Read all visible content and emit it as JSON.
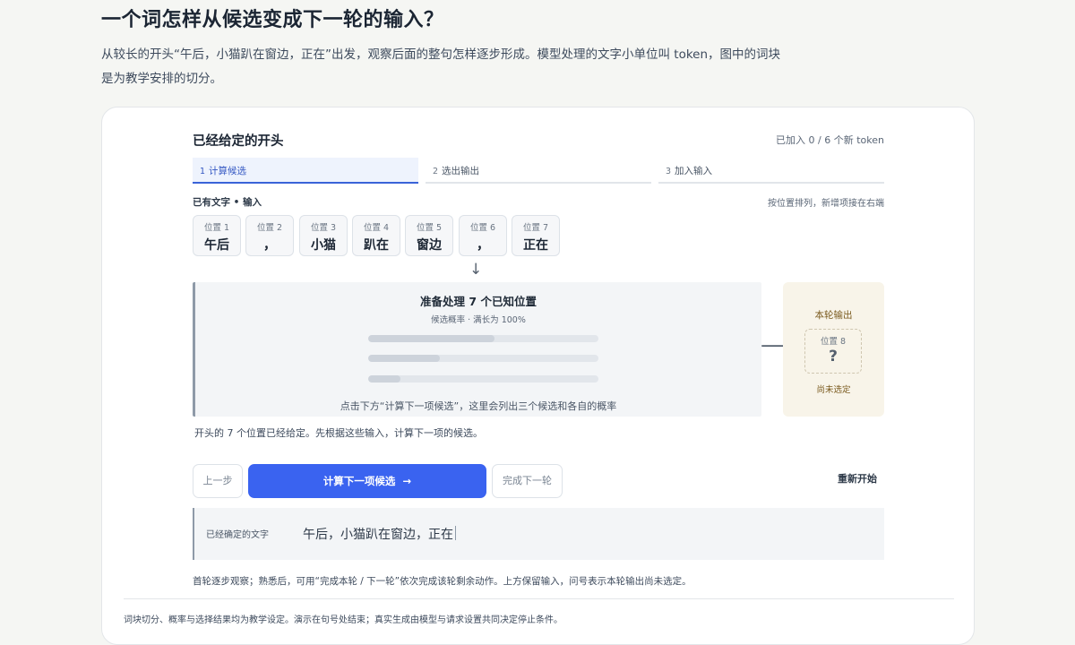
{
  "header": {
    "title": "一个词怎样从候选变成下一轮的输入？",
    "description": "从较长的开头“午后，小猫趴在窗边，正在”出发，观察后面的整句怎样逐步形成。模型处理的文字小单位叫 token，图中的词块是为教学安排的切分。"
  },
  "panel": {
    "title": "已经给定的开头",
    "counter": "已加入 0 / 6 个新 token",
    "steps": [
      {
        "num": "1",
        "label": "计算候选"
      },
      {
        "num": "2",
        "label": "选出输出"
      },
      {
        "num": "3",
        "label": "加入输入"
      }
    ],
    "active_step": 1,
    "existing_label": "已有文字 • 输入",
    "order_hint": "按位置排列，新增项接在右端",
    "tokens": [
      {
        "pos": "位置 1",
        "text": "午后"
      },
      {
        "pos": "位置 2",
        "text": "，"
      },
      {
        "pos": "位置 3",
        "text": "小猫"
      },
      {
        "pos": "位置 4",
        "text": "趴在"
      },
      {
        "pos": "位置 5",
        "text": "窗边"
      },
      {
        "pos": "位置 6",
        "text": "，"
      },
      {
        "pos": "位置 7",
        "text": "正在"
      }
    ],
    "arrow_down": "↓",
    "arrow_right": "⟶",
    "process": {
      "title": "准备处理 7 个已知位置",
      "subtitle": "候选概率 · 满长为 100%",
      "placeholder_bars": [
        0.55,
        0.31,
        0.14
      ],
      "hint": "点击下方“计算下一项候选”，这里会列出三个候选和各自的概率"
    },
    "output": {
      "title": "本轮输出",
      "pos": "位置 8",
      "mark": "?",
      "status": "尚未选定"
    },
    "step_note": "开头的 7 个位置已经给定。先根据这些输入，计算下一项的候选。",
    "buttons": {
      "prev": "上一步",
      "compute": "计算下一项候选",
      "compute_arrow": "→",
      "finish": "完成下一轮",
      "restart": "重新开始"
    },
    "confirmed": {
      "label": "已经确定的文字",
      "text": "午后，小猫趴在窗边，正在"
    },
    "footer_hint": "首轮逐步观察；熟悉后，可用“完成本轮 / 下一轮”依次完成该轮剩余动作。上方保留输入，问号表示本轮输出尚未选定。"
  },
  "footer": {
    "note": "词块切分、概率与选择结果均为教学设定。演示在句号处结束；真实生成由模型与请求设置共同决定停止条件。"
  },
  "colors": {
    "accent": "#3a63f0",
    "active_step_bg": "#eef3fd",
    "output_bg": "#f8f4e9",
    "page_bg": "#f5f6f3"
  }
}
